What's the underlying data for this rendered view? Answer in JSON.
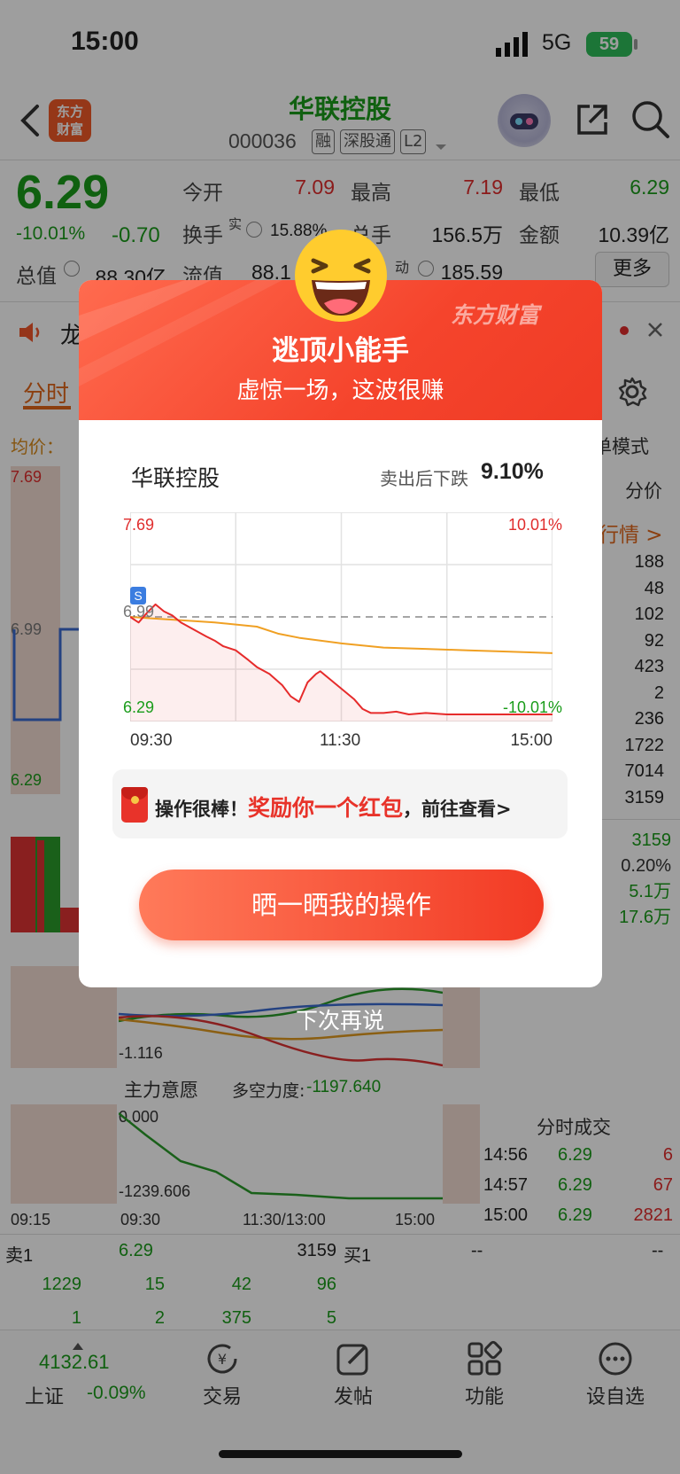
{
  "status_bar": {
    "time": "15:00",
    "network": "5G",
    "battery": "59"
  },
  "header": {
    "title": "华联控股",
    "code": "000036",
    "tags": [
      "融",
      "深股通",
      "L2"
    ],
    "logo_text": "东方\n财富"
  },
  "quote": {
    "price": "6.29",
    "change_pct": "-10.01%",
    "change": "-0.70",
    "open_label": "今开",
    "open": "7.09",
    "high_label": "最高",
    "high": "7.19",
    "low_label": "最低",
    "low": "6.29",
    "turnover_label": "换手",
    "turnover_sup": "实",
    "turnover": "15.88%",
    "volume_label": "总手",
    "volume": "156.5万",
    "amount_label": "金额",
    "amount": "10.39亿",
    "mktcap_label": "总值",
    "mktcap": "88.30亿",
    "float_label": "流值",
    "float": "88.1",
    "pe_label": "动",
    "pe": "185.59",
    "more_label": "更多"
  },
  "news_ticker": {
    "text": "龙"
  },
  "tabs": {
    "intraday": "分时"
  },
  "chart_bg": {
    "avg_label": "均价：",
    "price_top": "7.69",
    "price_mid": "6.99",
    "price_bot": "6.29",
    "mode_label": "单模式",
    "fen_label": "分价",
    "market_link": "行情 >",
    "side_values": [
      "188",
      "48",
      "102",
      "92",
      "423",
      "2",
      "236",
      "1722",
      "7014",
      "3159"
    ],
    "stats": [
      "3159",
      "0.20%",
      "5.1万",
      "17.6万"
    ],
    "flow_value": "-1.116",
    "main_will_label": "主力意愿",
    "bull_bear_label": "多空力度:",
    "bull_bear_value": "-1197.640",
    "flow_top": "0.000",
    "flow_bot": "-1239.606",
    "time_axis": [
      "09:15",
      "09:30",
      "11:30/13:00",
      "15:00"
    ],
    "trades_title": "分时成交",
    "trades": [
      {
        "time": "14:56",
        "price": "6.29",
        "vol": "6"
      },
      {
        "time": "14:57",
        "price": "6.29",
        "vol": "67"
      },
      {
        "time": "15:00",
        "price": "6.29",
        "vol": "2821"
      }
    ]
  },
  "order_book": {
    "sell1_label": "卖1",
    "sell1_price": "6.29",
    "sell1_vol": "3159",
    "buy1_label": "买1",
    "buy1_price": "--",
    "buy1_vol": "--",
    "row2": [
      "1229",
      "15",
      "42",
      "96"
    ],
    "row3": [
      "1",
      "2",
      "375",
      "5"
    ]
  },
  "bottom_nav": {
    "index_value": "4132.61",
    "index_name": "上证",
    "index_change": "-0.09%",
    "items": [
      "交易",
      "发帖",
      "功能",
      "设自选"
    ]
  },
  "dialog": {
    "title": "逃顶小能手",
    "subtitle": "虚惊一场，这波很赚",
    "watermark": "东方财富",
    "stock_name": "华联控股",
    "drop_label": "卖出后下跌",
    "drop_value": "9.10%",
    "reward_prefix": "操作很棒！",
    "reward_highlight": "奖励你一个红包",
    "reward_suffix": "，前往查看>",
    "share_button": "晒一晒我的操作",
    "later": "下次再说",
    "sell_marker": "S"
  },
  "chart_data": {
    "type": "line",
    "ylim": [
      6.29,
      7.69
    ],
    "y_ticks_left": [
      "7.69",
      "6.99",
      "6.29"
    ],
    "y_ticks_right": [
      "10.01%",
      "-10.01%"
    ],
    "x_ticks": [
      "09:30",
      "11:30",
      "15:00"
    ],
    "ref_price": 6.99,
    "series": [
      {
        "color": "#e62b2b",
        "x": [
          0,
          0.02,
          0.04,
          0.06,
          0.08,
          0.1,
          0.12,
          0.15,
          0.18,
          0.2,
          0.22,
          0.25,
          0.28,
          0.3,
          0.33,
          0.36,
          0.38,
          0.4,
          0.42,
          0.44,
          0.45,
          0.47,
          0.49,
          0.51,
          0.53,
          0.55,
          0.57,
          0.6,
          0.63,
          0.66,
          0.7,
          0.75,
          0.8,
          0.85,
          0.9,
          0.95,
          1.0
        ],
        "values": [
          6.99,
          6.95,
          7.02,
          7.08,
          7.03,
          7.0,
          6.95,
          6.9,
          6.85,
          6.82,
          6.78,
          6.75,
          6.68,
          6.63,
          6.58,
          6.5,
          6.42,
          6.38,
          6.52,
          6.58,
          6.6,
          6.55,
          6.5,
          6.45,
          6.4,
          6.33,
          6.3,
          6.3,
          6.31,
          6.29,
          6.3,
          6.29,
          6.29,
          6.29,
          6.29,
          6.29,
          6.29
        ]
      },
      {
        "color": "#f0a023",
        "x": [
          0,
          0.05,
          0.1,
          0.2,
          0.3,
          0.35,
          0.4,
          0.5,
          0.6,
          0.7,
          0.8,
          0.9,
          1.0
        ],
        "values": [
          6.99,
          6.98,
          6.97,
          6.95,
          6.92,
          6.87,
          6.84,
          6.8,
          6.77,
          6.76,
          6.75,
          6.74,
          6.73
        ]
      }
    ]
  }
}
